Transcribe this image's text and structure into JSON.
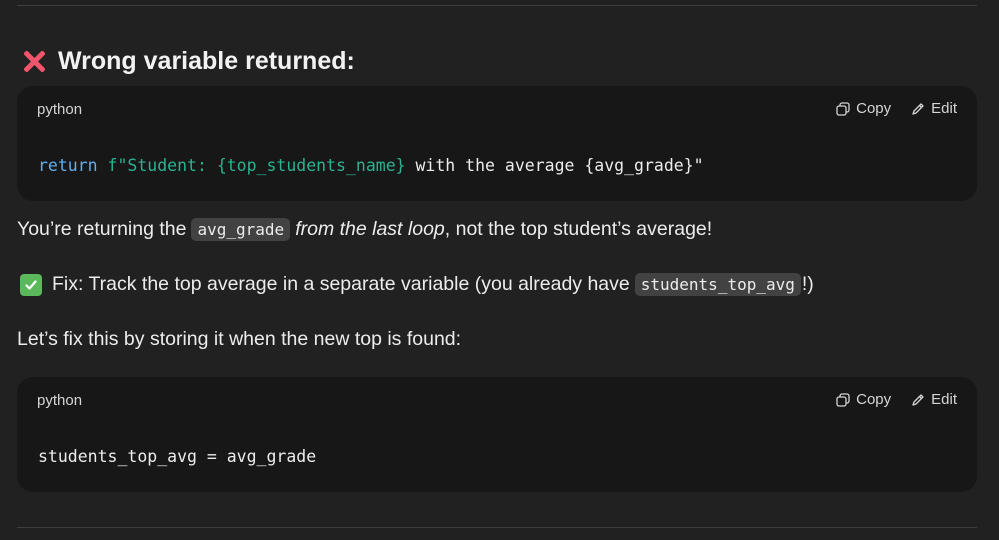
{
  "heading": {
    "icon": "cross-mark-icon",
    "text": "Wrong variable returned:"
  },
  "code_block_1": {
    "language": "python",
    "copy_label": "Copy",
    "edit_label": "Edit",
    "code": {
      "keyword": "return",
      "fstring": "f\"Student: {top_students_name}",
      "rest": " with the average {avg_grade}\""
    }
  },
  "paragraph_1": {
    "text_before": "You’re returning the",
    "inline_code": "avg_grade",
    "italic": "from the last loop",
    "text_after": ", not the top student’s average!"
  },
  "paragraph_2": {
    "icon": "check-mark-button-icon",
    "text_before": "Fix: Track the top average in a separate variable (you already have",
    "inline_code": "students_top_avg",
    "text_after": "!)"
  },
  "paragraph_3": {
    "text": "Let’s fix this by storing it when the new top is found:"
  },
  "code_block_2": {
    "language": "python",
    "copy_label": "Copy",
    "edit_label": "Edit",
    "code": "students_top_avg = avg_grade"
  },
  "colors": {
    "background": "#212121",
    "code_background": "#171717",
    "keyword": "#61aeee",
    "string": "#2ab391",
    "cross": "#f0556b",
    "check": "#5bb85b"
  }
}
